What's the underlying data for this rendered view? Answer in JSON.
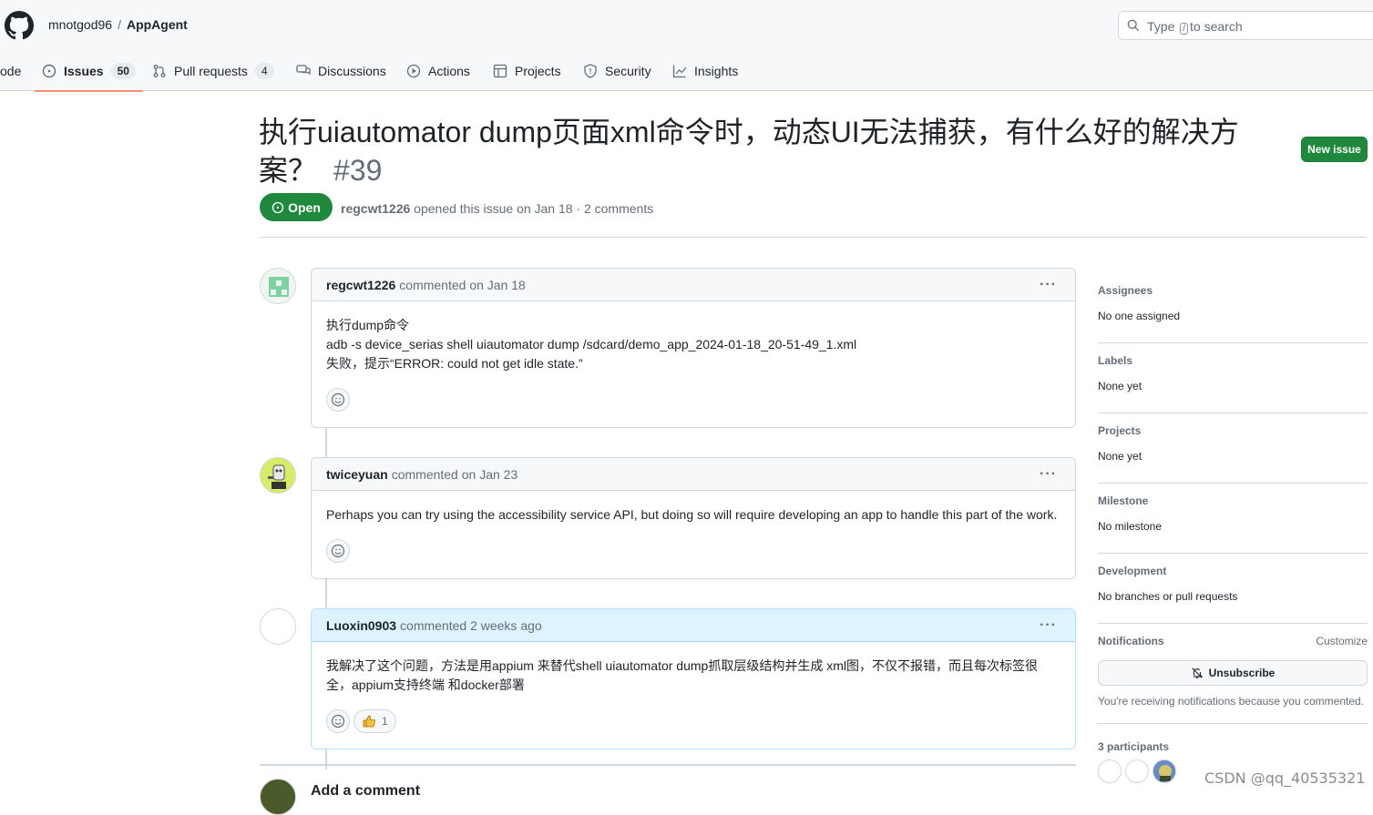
{
  "header": {
    "owner": "mnotgod96",
    "separator": "/",
    "repo": "AppAgent",
    "search_prefix": "Type",
    "search_key": "/",
    "search_suffix": "to search"
  },
  "tabs": [
    {
      "label": "ode",
      "icon": "code-icon"
    },
    {
      "label": "Issues",
      "count": "50",
      "icon": "issue-icon",
      "active": true
    },
    {
      "label": "Pull requests",
      "count": "4",
      "icon": "pull-request-icon"
    },
    {
      "label": "Discussions",
      "icon": "discussion-icon"
    },
    {
      "label": "Actions",
      "icon": "play-icon"
    },
    {
      "label": "Projects",
      "icon": "table-icon"
    },
    {
      "label": "Security",
      "icon": "shield-icon"
    },
    {
      "label": "Insights",
      "icon": "graph-icon"
    }
  ],
  "issue": {
    "title": "执行uiautomator dump页面xml命令时，动态UI无法捕获，有什么好的解决方案？",
    "number": "#39",
    "state": "Open",
    "author": "regcwt1226",
    "meta": "opened this issue on Jan 18 · 2 comments",
    "new_issue_label": "New issue"
  },
  "comments": [
    {
      "author": "regcwt1226",
      "when": "commented on Jan 18",
      "lines": [
        "执行dump命令",
        "adb -s device_serias shell uiautomator dump /sdcard/demo_app_2024-01-18_20-51-49_1.xml",
        "失败，提示“ERROR: could not get idle state.”"
      ]
    },
    {
      "author": "twiceyuan",
      "when": "commented on Jan 23",
      "lines": [
        "Perhaps you can try using the accessibility service API, but doing so will require developing an app to handle this part of the work."
      ]
    },
    {
      "author": "Luoxin0903",
      "when": "commented 2 weeks ago",
      "lines": [
        "我解决了这个问题，方法是用appium 来替代shell uiautomator dump抓取层级结构并生成 xml图，不仅不报错，而且每次标签很全，appium支持终端 和docker部署"
      ],
      "thumbs_up": "1"
    }
  ],
  "add_comment": "Add a comment",
  "sidebar": {
    "assignees": {
      "title": "Assignees",
      "value": "No one assigned"
    },
    "labels": {
      "title": "Labels",
      "value": "None yet"
    },
    "projects": {
      "title": "Projects",
      "value": "None yet"
    },
    "milestone": {
      "title": "Milestone",
      "value": "No milestone"
    },
    "development": {
      "title": "Development",
      "value": "No branches or pull requests"
    },
    "notifications": {
      "title": "Notifications",
      "customize": "Customize",
      "unsubscribe": "Unsubscribe",
      "note": "You're receiving notifications because you commented."
    },
    "participants": {
      "title": "3 participants"
    }
  },
  "watermark": "CSDN @qq_40535321",
  "colors": {
    "green": "#1f883d",
    "tab_underline": "#fd8c73",
    "comment_highlight": "#ddf4ff"
  }
}
